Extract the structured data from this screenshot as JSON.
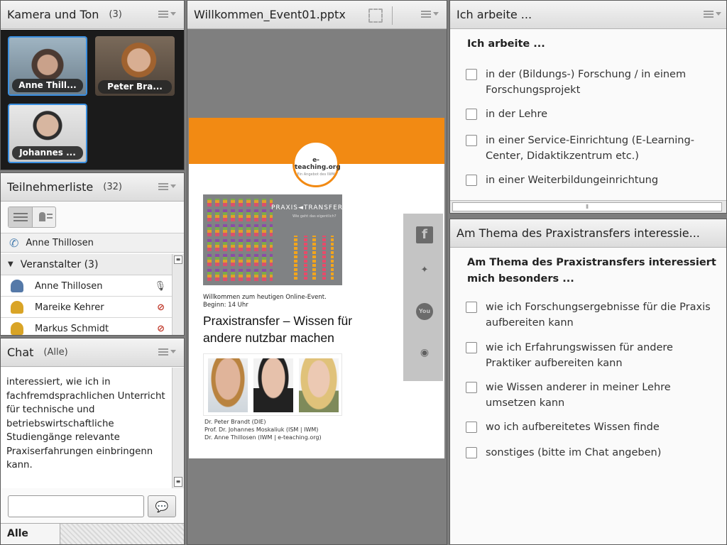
{
  "camera_pod": {
    "title": "Kamera und Ton",
    "count": "(3)",
    "tiles": [
      "Anne Thill...",
      "Peter Bra...",
      "Johannes ..."
    ]
  },
  "attendee_pod": {
    "title": "Teilnehmerliste",
    "count": "(32)",
    "current_speaker": "Anne Thillosen",
    "group_label": "Veranstalter (3)",
    "hosts": [
      "Anne Thillosen",
      "Mareike Kehrer",
      "Markus Schmidt"
    ]
  },
  "chat_pod": {
    "title": "Chat",
    "count": "(Alle)",
    "message": "interessiert, wie ich in fachfremdsprachlichen Unterricht für technische und betriebswirtschaftliche Studiengänge relevante Praxiserfahrungen einbringenn kann.",
    "input_placeholder": "",
    "tab_label": "Alle"
  },
  "share_pod": {
    "title": "Willkommen_Event01.pptx",
    "slide": {
      "logo_text": "e-teaching.org",
      "logo_subtext": "Ein Angebot des IWM",
      "banner_title": "PRAXIS◄TRANSFER",
      "banner_subtitle": "Wie geht das eigentlich?",
      "welcome_line1": "Willkommen zum heutigen Online-Event.",
      "welcome_line2": "Beginn: 14 Uhr",
      "headline_line1": "Praxistransfer – Wissen für",
      "headline_line2": "andere nutzbar machen",
      "speakers": [
        "Dr. Peter Brandt (DIE)",
        "Prof. Dr. Johannes Moskaliuk (ISM | IWM)",
        "Dr. Anne Thillosen (IWM | e-teaching.org)"
      ],
      "social": [
        "facebook-icon",
        "twitter-icon",
        "youtube-icon",
        "slideshare-icon"
      ]
    }
  },
  "poll1": {
    "title": "Ich arbeite ...",
    "question": "Ich arbeite ...",
    "options": [
      "in der (Bildungs-) Forschung / in einem Forschungsprojekt",
      "in der Lehre",
      "in einer Service-Einrichtung (E-Learning-Center, Didaktikzentrum etc.)",
      "in einer Weiterbildungeinrichtung"
    ]
  },
  "poll2": {
    "title": "Am Thema des Praxistransfers interessie...",
    "question": "Am Thema des Praxistransfers interessiert mich besonders ...",
    "options": [
      "wie ich Forschungsergebnisse für die Praxis aufbereiten kann",
      "wie ich Erfahrungswissen für andere Praktiker aufbereiten kann",
      "wie Wissen anderer in meiner Lehre umsetzen kann",
      "wo ich aufbereitetes Wissen finde",
      "sonstiges (bitte im Chat angeben)"
    ]
  }
}
